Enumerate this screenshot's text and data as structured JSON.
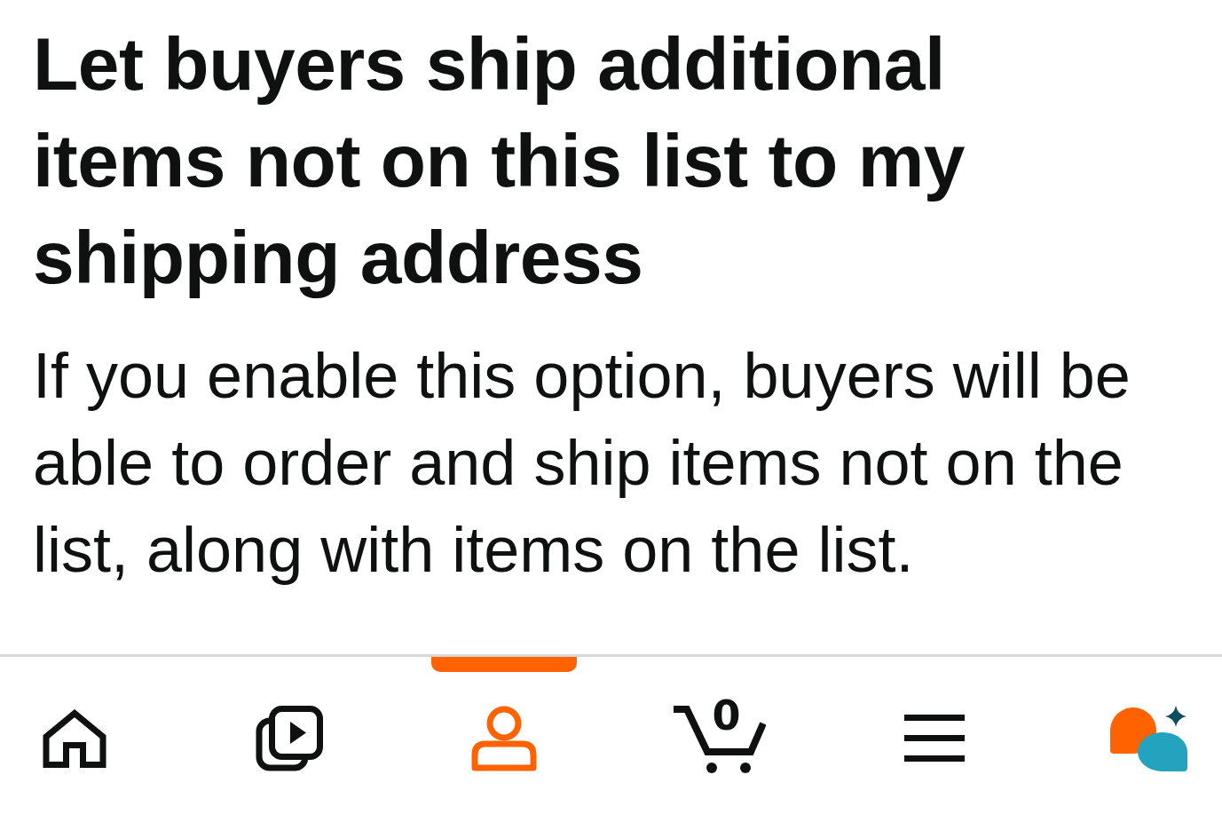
{
  "content": {
    "heading": "Let buyers ship additional items not on this list to my shipping address",
    "description": "If you enable this option, buyers will be able to order and ship items not on the list, along with items on the list."
  },
  "bottom_nav": {
    "items": [
      {
        "selected": false
      },
      {
        "selected": false
      },
      {
        "selected": true
      },
      {
        "selected": false,
        "count": "0"
      },
      {
        "selected": false
      },
      {
        "selected": false
      }
    ]
  }
}
